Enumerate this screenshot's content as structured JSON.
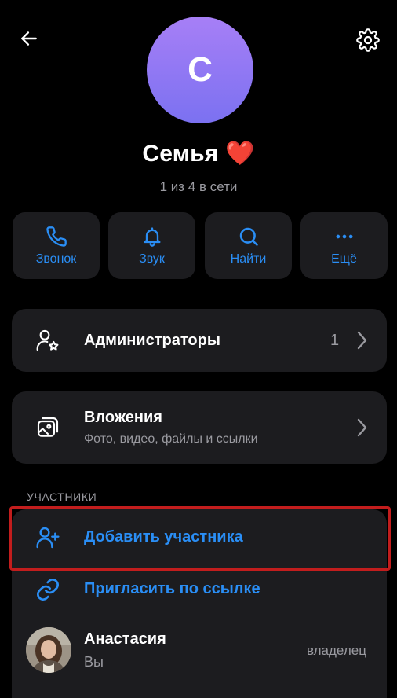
{
  "header": {
    "back_icon": "arrow-left-icon",
    "settings_icon": "gear-icon"
  },
  "profile": {
    "avatar_letter": "С",
    "avatar_colors": [
      "#a77ff6",
      "#7b71f1"
    ],
    "title": "Семья ❤️",
    "status": "1 из 4 в сети"
  },
  "actions": [
    {
      "label": "Звонок",
      "icon": "phone-icon"
    },
    {
      "label": "Звук",
      "icon": "bell-icon"
    },
    {
      "label": "Найти",
      "icon": "search-icon"
    },
    {
      "label": "Ещё",
      "icon": "more-dots-icon"
    }
  ],
  "admins": {
    "label": "Администраторы",
    "count": "1",
    "icon": "user-star-icon"
  },
  "attachments": {
    "label": "Вложения",
    "sublabel": "Фото, видео, файлы и ссылки",
    "icon": "images-icon"
  },
  "members": {
    "section_title": "УЧАСТНИКИ",
    "add_member": "Добавить участника",
    "invite_link": "Пригласить по ссылке",
    "list": [
      {
        "name": "Анастасия",
        "subtitle": "Вы",
        "role": "владелец"
      }
    ]
  },
  "colors": {
    "accent": "#2a8ef5",
    "card": "#1c1c1f",
    "background": "#000000",
    "highlight": "#c21d1d"
  }
}
